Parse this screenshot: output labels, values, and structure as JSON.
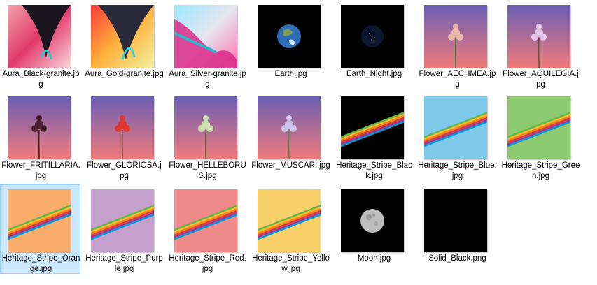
{
  "files": [
    {
      "name": "Aura_Black-granite.jpg",
      "thumb_style": "aura-black"
    },
    {
      "name": "Aura_Gold-granite.jpg",
      "thumb_style": "aura-gold"
    },
    {
      "name": "Aura_Silver-granite.jpg",
      "thumb_style": "aura-silver"
    },
    {
      "name": "Earth.jpg",
      "thumb_style": "earth"
    },
    {
      "name": "Earth_Night.jpg",
      "thumb_style": "earth-night"
    },
    {
      "name": "Flower_AECHMEA.jpg",
      "thumb_style": "flower-aechmea"
    },
    {
      "name": "Flower_AQUILEGIA.jpg",
      "thumb_style": "flower-aquilegia"
    },
    {
      "name": "Flower_FRITILLARIA.jpg",
      "thumb_style": "flower-fritillaria"
    },
    {
      "name": "Flower_GLORIOSA.jpg",
      "thumb_style": "flower-gloriosa"
    },
    {
      "name": "Flower_HELLEBORUS.jpg",
      "thumb_style": "flower-helleborus"
    },
    {
      "name": "Flower_MUSCARI.jpg",
      "thumb_style": "flower-muscari"
    },
    {
      "name": "Heritage_Stripe_Black.jpg",
      "thumb_style": "stripe",
      "background": "#000000"
    },
    {
      "name": "Heritage_Stripe_Blue.jpg",
      "thumb_style": "stripe",
      "background": "#7ec8ea"
    },
    {
      "name": "Heritage_Stripe_Green.jpg",
      "thumb_style": "stripe",
      "background": "#8cc96f"
    },
    {
      "name": "Heritage_Stripe_Orange.jpg",
      "thumb_style": "stripe",
      "background": "#f8ac6a",
      "selected": true
    },
    {
      "name": "Heritage_Stripe_Purple.jpg",
      "thumb_style": "stripe",
      "background": "#c6a0cc"
    },
    {
      "name": "Heritage_Stripe_Red.jpg",
      "thumb_style": "stripe",
      "background": "#ef8a8a"
    },
    {
      "name": "Heritage_Stripe_Yellow.jpg",
      "thumb_style": "stripe",
      "background": "#f9cf6a"
    },
    {
      "name": "Moon.jpg",
      "thumb_style": "moon"
    },
    {
      "name": "Solid_Black.png",
      "thumb_style": "solid-black"
    }
  ],
  "colors": {
    "selection_fill": "#cce8ff",
    "selection_border": "#99d1ff",
    "rainbow": [
      "#5cb947",
      "#fdb827",
      "#f5821f",
      "#e03a3e",
      "#963d97",
      "#009ddc"
    ]
  }
}
